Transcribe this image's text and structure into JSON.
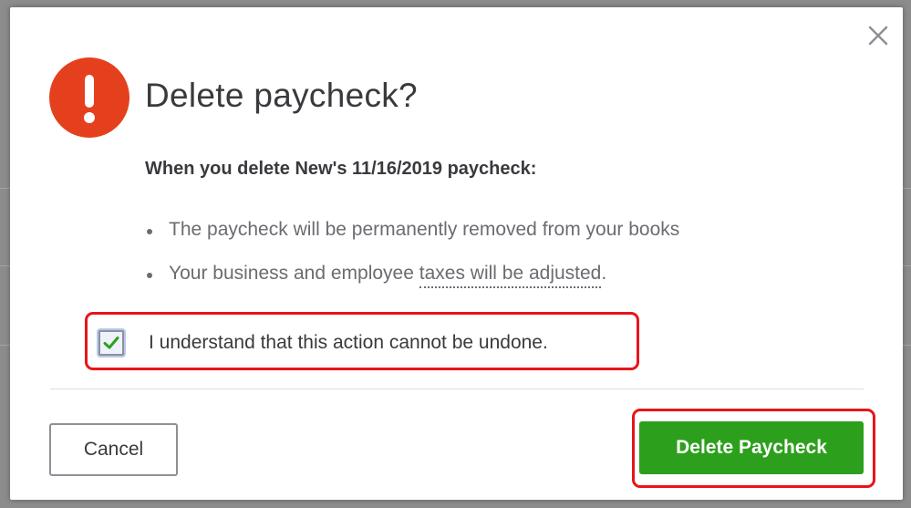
{
  "dialog": {
    "title": "Delete paycheck?",
    "subtitle": "When you delete New's 11/16/2019 paycheck:",
    "bullets": {
      "item1": "The paycheck will be permanently removed from your books",
      "item2_prefix": "Your business and employee ",
      "item2_link": "taxes will be adjusted",
      "item2_suffix": "."
    },
    "confirm": {
      "label": "I understand that this action cannot be undone.",
      "checked": true
    },
    "buttons": {
      "cancel": "Cancel",
      "delete": "Delete Paycheck"
    }
  },
  "icons": {
    "close": "close-icon",
    "alert": "exclamation-icon",
    "check": "checkmark-icon"
  },
  "colors": {
    "alert": "#e5401d",
    "primary_button": "#2ca01c",
    "highlight": "#e8141a",
    "checkmark": "#2ca01c"
  }
}
